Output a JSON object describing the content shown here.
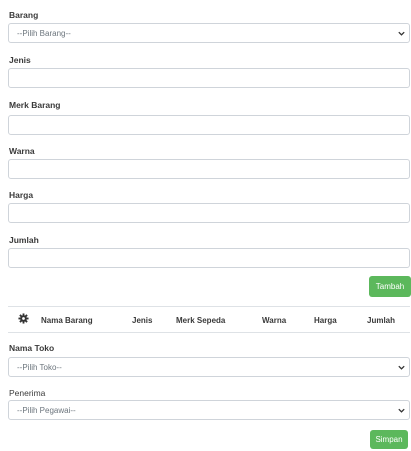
{
  "form": {
    "barang": {
      "label": "Barang",
      "placeholder": "--Pilih Barang--"
    },
    "jenis": {
      "label": "Jenis",
      "value": ""
    },
    "merk_barang": {
      "label": "Merk Barang",
      "value": ""
    },
    "warna": {
      "label": "Warna",
      "value": ""
    },
    "harga": {
      "label": "Harga",
      "value": ""
    },
    "jumlah": {
      "label": "Jumlah",
      "value": ""
    },
    "tambah_label": "Tambah"
  },
  "table": {
    "settings_icon": "gear-icon",
    "columns": [
      "Nama Barang",
      "Jenis",
      "Merk Sepeda",
      "Warna",
      "Harga",
      "Jumlah"
    ]
  },
  "footer": {
    "nama_toko": {
      "label": "Nama Toko",
      "placeholder": "--Pilih Toko--"
    },
    "penerima": {
      "label": "Penerima",
      "placeholder": "--Pilih Pegawai--"
    },
    "simpan_label": "Simpan"
  },
  "colors": {
    "button": "#5cb85c",
    "border": "#cfd4da",
    "placeholder_text": "#6c757d"
  }
}
